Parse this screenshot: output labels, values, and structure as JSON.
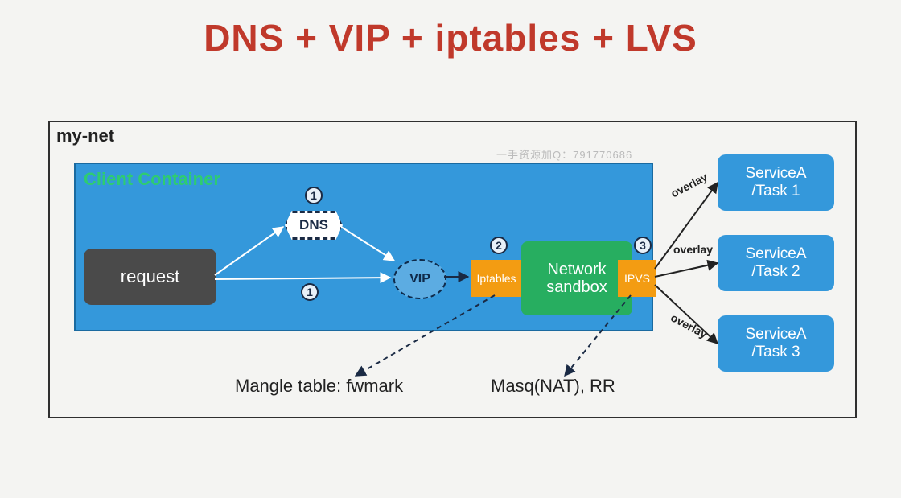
{
  "title": "DNS + VIP + iptables + LVS",
  "diagram": {
    "outer_label": "my-net",
    "client_label": "Client Container",
    "request": "request",
    "dns": "DNS",
    "vip": "VIP",
    "iptables": "Iptables",
    "sandbox": "Network\nsandbox",
    "ipvs": "IPVS",
    "badges": {
      "one_a": "1",
      "one_b": "1",
      "two": "2",
      "three": "3"
    },
    "services": {
      "s1": "ServiceA\n/Task 1",
      "s2": "ServiceA\n/Task 2",
      "s3": "ServiceA\n/Task 3"
    },
    "overlay_label": "overlay",
    "annotations": {
      "mangle": "Mangle table: fwmark",
      "masq": "Masq(NAT), RR"
    },
    "watermark": "一手资源加Q：791770686"
  }
}
